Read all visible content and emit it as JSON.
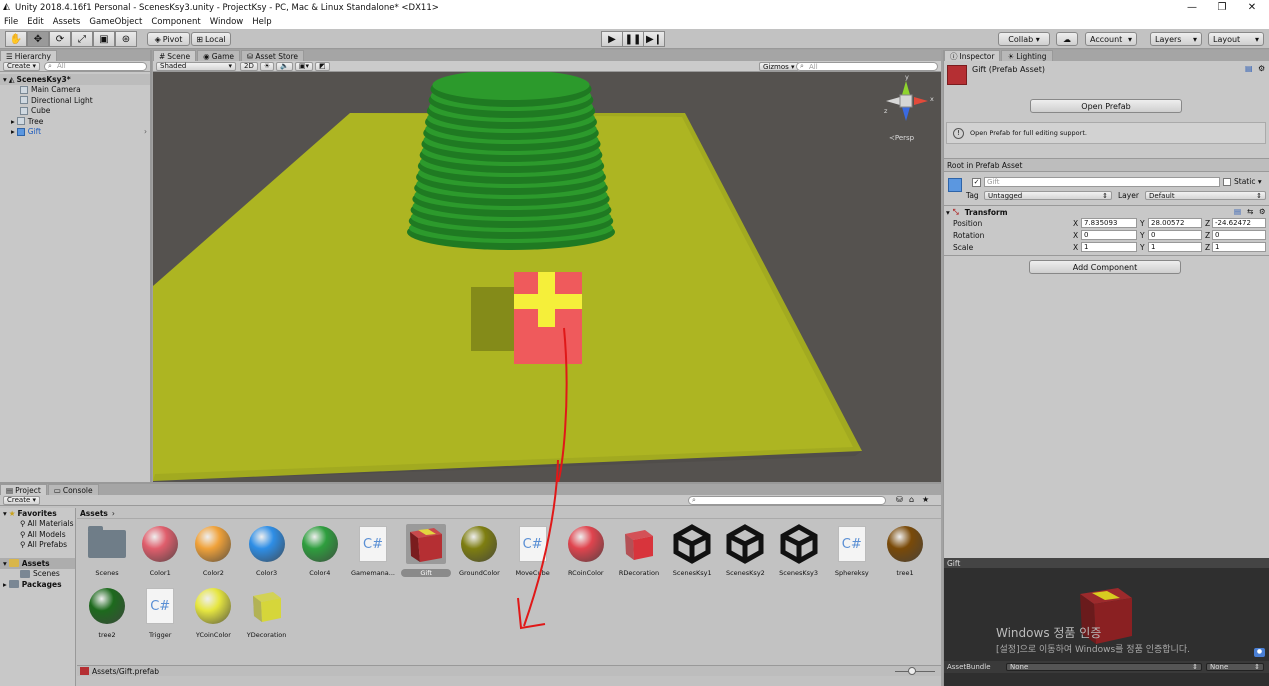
{
  "title_bar": {
    "title": "Unity 2018.4.16f1 Personal - ScenesKsy3.unity - ProjectKsy - PC, Mac & Linux Standalone* <DX11>"
  },
  "menu": [
    "File",
    "Edit",
    "Assets",
    "GameObject",
    "Component",
    "Window",
    "Help"
  ],
  "toolbar": {
    "pivot": "Pivot",
    "local": "Local",
    "collab": "Collab ▾",
    "account": "Account",
    "layers": "Layers",
    "layout": "Layout"
  },
  "hierarchy": {
    "tab": "Hierarchy",
    "create": "Create",
    "search_placeholder": "All",
    "scene": "ScenesKsy3*",
    "items": [
      "Main Camera",
      "Directional Light",
      "Cube",
      "Tree",
      "Gift"
    ]
  },
  "scene_view": {
    "tabs": [
      "Scene",
      "Game",
      "Asset Store"
    ],
    "shading": "Shaded",
    "mode_2d": "2D",
    "gizmos": "Gizmos",
    "search_placeholder": "All",
    "gizmo_label": "Persp",
    "gizmo_axes": [
      "y",
      "x",
      "z"
    ]
  },
  "project": {
    "tabs": [
      "Project",
      "Console"
    ],
    "create": "Create",
    "favorites": {
      "label": "Favorites",
      "items": [
        "All Materials",
        "All Models",
        "All Prefabs"
      ]
    },
    "assets_root": "Assets",
    "scenes_folder": "Scenes",
    "packages": "Packages",
    "breadcrumb": "Assets",
    "assets": [
      {
        "name": "Scenes",
        "kind": "folder",
        "color": "#6f7d88"
      },
      {
        "name": "Color1",
        "kind": "sphere",
        "color": "#e05e6c"
      },
      {
        "name": "Color2",
        "kind": "sphere",
        "color": "#f0a23a"
      },
      {
        "name": "Color3",
        "kind": "sphere",
        "color": "#2e8ee6"
      },
      {
        "name": "Color4",
        "kind": "sphere",
        "color": "#2e9e3e"
      },
      {
        "name": "Gamemana...",
        "kind": "script",
        "color": "#5a8fd4"
      },
      {
        "name": "Gift",
        "kind": "prefab",
        "color": "#b52f33"
      },
      {
        "name": "GroundColor",
        "kind": "sphere",
        "color": "#7e7e10"
      },
      {
        "name": "MoveCube",
        "kind": "script",
        "color": "#5a8fd4"
      },
      {
        "name": "RCoinColor",
        "kind": "sphere",
        "color": "#e0444e"
      },
      {
        "name": "RDecoration",
        "kind": "cube",
        "color": "#d8343c"
      },
      {
        "name": "ScenesKsy1",
        "kind": "unity",
        "color": "#111111"
      },
      {
        "name": "ScenesKsy2",
        "kind": "unity",
        "color": "#111111"
      },
      {
        "name": "ScenesKsy3",
        "kind": "unity",
        "color": "#111111"
      },
      {
        "name": "Sphereksy",
        "kind": "script",
        "color": "#5a8fd4"
      },
      {
        "name": "tree1",
        "kind": "sphere",
        "color": "#7a4a08"
      },
      {
        "name": "tree2",
        "kind": "sphere",
        "color": "#1d6a1d"
      },
      {
        "name": "Trigger",
        "kind": "script",
        "color": "#5a8fd4"
      },
      {
        "name": "YCoinColor",
        "kind": "sphere",
        "color": "#e6e640"
      },
      {
        "name": "YDecoration",
        "kind": "cube",
        "color": "#d6d63a"
      }
    ],
    "status_path": "Assets/Gift.prefab"
  },
  "inspector": {
    "tabs": [
      "Inspector",
      "Lighting"
    ],
    "asset_title": "Gift (Prefab Asset)",
    "open_prefab": "Open Prefab",
    "info": "Open Prefab for full editing support.",
    "root_label": "Root in Prefab Asset",
    "object_name": "Gift",
    "static": "Static",
    "tag_label": "Tag",
    "tag_value": "Untagged",
    "layer_label": "Layer",
    "layer_value": "Default",
    "transform": {
      "title": "Transform",
      "position": {
        "label": "Position",
        "x": "7.835093",
        "y": "28.00572",
        "z": "-24.62472"
      },
      "rotation": {
        "label": "Rotation",
        "x": "0",
        "y": "0",
        "z": "0"
      },
      "scale": {
        "label": "Scale",
        "x": "1",
        "y": "1",
        "z": "1"
      }
    },
    "add_component": "Add Component",
    "preview": {
      "title": "Gift",
      "watermark_1": "Windows 정품 인증",
      "watermark_2": "[설정]으로 이동하여 Windows를 정품 인증합니다.",
      "assetbundle_label": "AssetBundle",
      "assetbundle_value": "None",
      "variant_value": "None"
    }
  },
  "colors": {
    "ground": "#adb522",
    "tree": "#2c9a2c",
    "gift": "#ef5a5c",
    "ribbon": "#f5ef3a",
    "sky": "#55524f",
    "arrow": "#e01818"
  }
}
